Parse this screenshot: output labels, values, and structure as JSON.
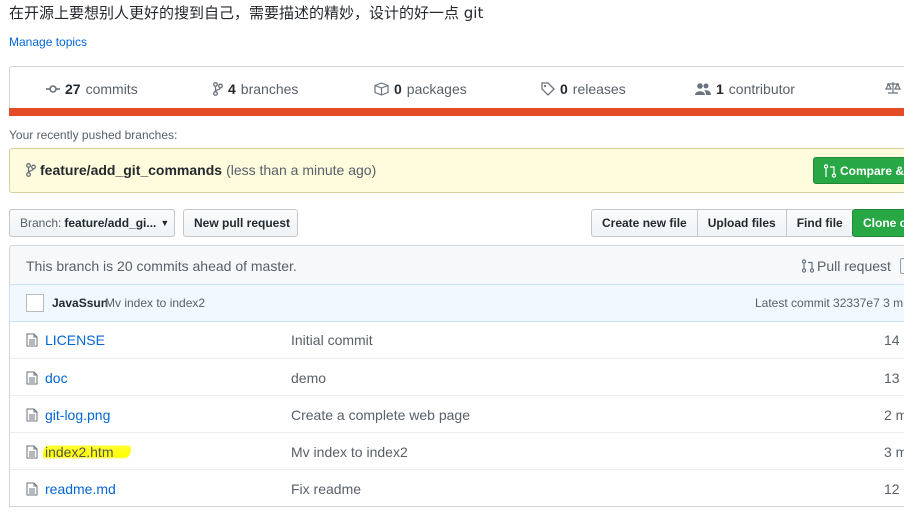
{
  "repo": {
    "description": "在开源上要想别人更好的搜到自己，需要描述的精妙，设计的好一点 git",
    "manage_topics": "Manage topics"
  },
  "stats": {
    "commits": {
      "count": "27",
      "label": "commits",
      "icon": "commit-icon"
    },
    "branches": {
      "count": "4",
      "label": "branches",
      "icon": "branch-icon"
    },
    "packages": {
      "count": "0",
      "label": "packages",
      "icon": "package-icon"
    },
    "releases": {
      "count": "0",
      "label": "releases",
      "icon": "tag-icon"
    },
    "contributors": {
      "count": "1",
      "label": "contributor",
      "icon": "people-icon"
    },
    "language_bar_color": "#e34c26"
  },
  "recent_push": {
    "label": "Your recently pushed branches:",
    "branch": "feature/add_git_commands",
    "time": "(less than a minute ago)",
    "compare_button": "Compare &"
  },
  "toolbar": {
    "branch_prefix": "Branch:",
    "branch_name": "feature/add_gi...",
    "new_pull_request": "New pull request",
    "create_new_file": "Create new file",
    "upload_files": "Upload files",
    "find_file": "Find file",
    "clone": "Clone o"
  },
  "branch_status": {
    "text": "This branch is 20 commits ahead of master.",
    "pull_request": "Pull request"
  },
  "latest_commit": {
    "author": "JavaSsun",
    "message": "Mv index to index2",
    "label": "Latest commit 32337e7 3 m"
  },
  "files": [
    {
      "name": "LICENSE",
      "message": "Initial commit",
      "age": "14",
      "highlighted": false
    },
    {
      "name": "doc",
      "message": "demo",
      "age": "13",
      "highlighted": false
    },
    {
      "name": "git-log.png",
      "message": "Create a complete web page",
      "age": "2 m",
      "highlighted": false
    },
    {
      "name": "index2.htm",
      "message": "Mv index to index2",
      "age": "3 m",
      "highlighted": true
    },
    {
      "name": "readme.md",
      "message": "Fix readme",
      "age": "12",
      "highlighted": false
    }
  ],
  "colors": {
    "link": "#0366d6",
    "green_button": "#28a745",
    "banner_bg": "#fffbdd",
    "highlight": "#ffff00"
  }
}
